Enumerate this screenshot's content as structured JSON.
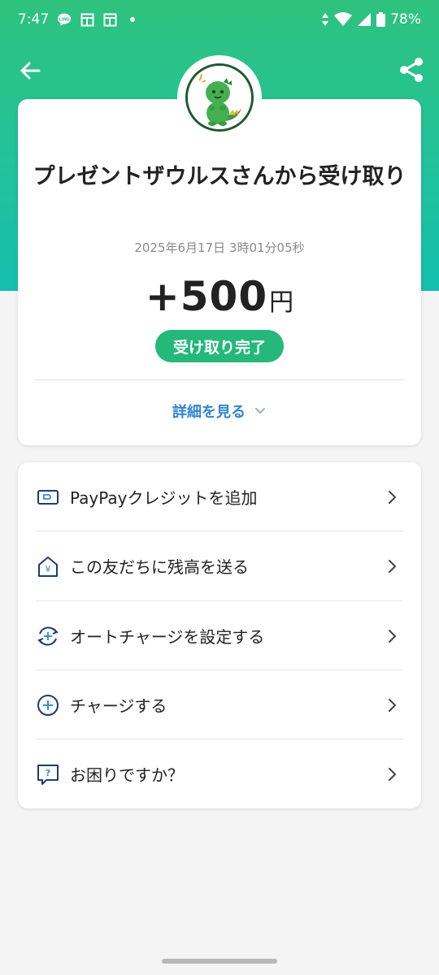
{
  "status_bar": {
    "time": "7:47",
    "battery": "78%",
    "icons": [
      "line-icon",
      "news-icon",
      "news-icon",
      "dot-icon",
      "data-arrows-icon",
      "wifi-icon",
      "signal-icon",
      "battery-icon"
    ]
  },
  "nav": {
    "back_icon": "arrow-left-icon",
    "share_icon": "share-icon"
  },
  "transaction": {
    "title": "プレゼントザウルスさんから受け取り",
    "timestamp": "2025年6月17日 3時01分05秒",
    "amount": "+500",
    "currency": "円",
    "status": "受け取り完了",
    "details_link": "詳細を見る"
  },
  "menu": {
    "items": [
      {
        "label": "PayPayクレジットを追加",
        "icon": "credit-card-icon"
      },
      {
        "label": "この友だちに残高を送る",
        "icon": "yen-house-icon"
      },
      {
        "label": "オートチャージを設定する",
        "icon": "auto-charge-icon"
      },
      {
        "label": "チャージする",
        "icon": "plus-circle-icon"
      },
      {
        "label": "お困りですか？",
        "icon": "help-chat-icon"
      }
    ]
  },
  "colors": {
    "header_top": "#2ec27e",
    "header_bottom": "#14bfae",
    "badge": "#25b87a",
    "link": "#2f86d6",
    "icon_navy": "#1f3a74"
  }
}
